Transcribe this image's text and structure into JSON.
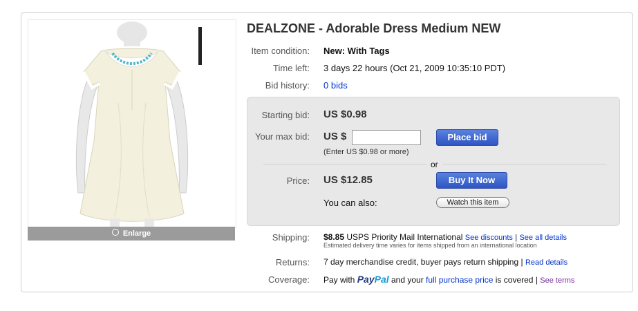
{
  "title": "DEALZONE - Adorable Dress Medium NEW",
  "image": {
    "enlarge_label": "Enlarge"
  },
  "details": {
    "condition_label": "Item condition:",
    "condition_value": "New: With Tags",
    "time_left_label": "Time left:",
    "time_left_value": "3 days 22 hours (Oct 21, 2009  10:35:10 PDT)",
    "bid_history_label": "Bid history:",
    "bid_history_value": "0 bids"
  },
  "bid": {
    "starting_label": "Starting bid:",
    "starting_value": "US $0.98",
    "max_label": "Your max bid:",
    "max_currency": "US $",
    "max_value": "",
    "hint": "(Enter US $0.98 or more)",
    "place_bid": "Place bid",
    "or": "or",
    "price_label": "Price:",
    "price_value": "US $12.85",
    "buy_now": "Buy It Now",
    "also_label": "You can also:",
    "watch": "Watch this item"
  },
  "shipping": {
    "label": "Shipping:",
    "amount": "$8.85",
    "method": "USPS Priority Mail International",
    "discounts_link": "See discounts",
    "sep": "|",
    "all_details_link": "See all details",
    "note": "Estimated delivery time varies for items shipped from an international location"
  },
  "returns": {
    "label": "Returns:",
    "text": "7 day merchandise credit, buyer pays return shipping",
    "sep": "|",
    "link": "Read details"
  },
  "coverage": {
    "label": "Coverage:",
    "pre": "Pay with",
    "paypal_1": "Pay",
    "paypal_2": "Pal",
    "mid": "and your",
    "link": "full purchase price",
    "post": "is covered",
    "sep": "|",
    "terms": "See terms"
  },
  "colors": {
    "link": "#0033cc",
    "button": "#3a5fcd",
    "bidbox": "#e8e8e8"
  }
}
